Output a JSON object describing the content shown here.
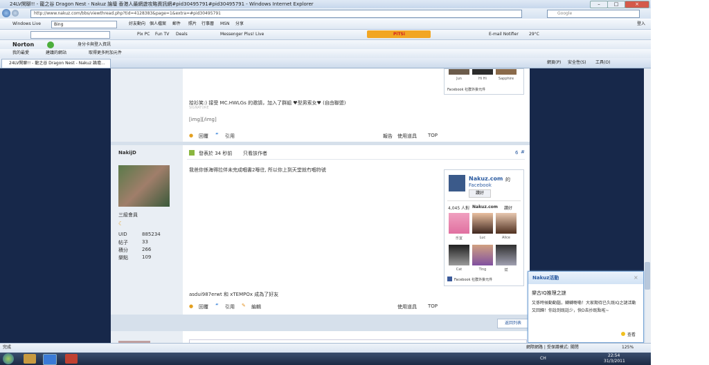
{
  "window": {
    "title": "24LV閑聊!! - 龍之谷 Dragon Nest - Nakuz 論壇 香港人最網遊攻略資訊網#pid30495791#pid30495791 - Windows Internet Explorer",
    "min": "–",
    "max": "□",
    "close": "×"
  },
  "address": {
    "url": "http://www.nakuz.com/bbs/viewthread.php?tid=4128383&page=1&extra=#pid30495791",
    "search_placeholder": "Google"
  },
  "toolbar_live": {
    "brand": "Windows Live",
    "search_value": "Bing",
    "items": [
      "好友動向",
      "個人檔案",
      "郵件",
      "照片",
      "行事曆",
      "MSN",
      "分享"
    ],
    "signin": "登入"
  },
  "toolbar_tools": {
    "items": [
      "Pix PC",
      "Fun TV",
      "Deals",
      "Messenger Plus! Live"
    ],
    "brand": "PiTSi",
    "email": "E-mail Notifier",
    "weather": "29°C"
  },
  "toolbar_norton": {
    "brand": "Norton",
    "identity": "身分卡與登入資訊"
  },
  "favorites": {
    "label": "我的最愛",
    "items": [
      "建議的網站",
      "取得更多附加元件"
    ]
  },
  "tab": {
    "label": "24LV閑聊!! - 龍之谷 Dragon Nest - Nakuz 論壇..."
  },
  "commandbar": {
    "page": "網頁(P)",
    "safety": "安全性(S)",
    "tools": "工具(O)"
  },
  "post1": {
    "fb_names": [
      "Jun",
      "Hi Hi",
      "Sapphire"
    ],
    "fb_plugin": "Facebook 社群外掛元件",
    "gift_text": "拾衫笑:) 接受 MC.HWLGs 的邀請，加入了群組 ♥型男索女♥ (自由聯盟)",
    "signature": "SIGNATURE",
    "img_text": "[img][/img]",
    "reply": "回覆",
    "quote": "引用",
    "report": "報告",
    "use_item": "使用道具",
    "top": "TOP"
  },
  "post2": {
    "author": "NakijD",
    "rank": "三級會員",
    "stats": [
      {
        "label": "UID",
        "value": "885234"
      },
      {
        "label": "帖子",
        "value": "33"
      },
      {
        "label": "積分",
        "value": "266"
      },
      {
        "label": "樂點",
        "value": "109"
      }
    ],
    "time": "發表於 34 秒前",
    "only_author": "只看該作者",
    "floor": "6",
    "floor_suffix": "#",
    "message": "我爸你係海得拉伴未完成嗰書2喺往, 所以你上到天堂就冇嗰符號",
    "fb": {
      "title": "Nakuz.com",
      "title_suffix": "的",
      "sub": "Facebook",
      "like": "讚好",
      "count_text": "4,045 人對",
      "count_brand": "Nakuz.com",
      "count_suffix": "讚好",
      "friends": [
        "乐宜",
        "Luc",
        "Alice",
        "Cat",
        "Ting",
        "斌"
      ],
      "plugin": "Facebook 社群外掛元件"
    },
    "rate_text": "asdui987erwt 和 xTEMPOx 成為了好友",
    "reply": "回覆",
    "quote": "引用",
    "edit": "編輯",
    "use_item": "使用道具",
    "top": "TOP",
    "back": "返回列表"
  },
  "popup": {
    "title": "Nakuz活動",
    "close": "×",
    "heading": "樂古IQ推理之謎",
    "body": "又係時候動動腦，轉轉嘢嘞！大家期待已久既IQ之謎活動又回歸！你諗到既話少，快D去抄既點啦~",
    "action": "查看"
  },
  "status": {
    "left": "完成",
    "zone": "網際網路 | 受保護模式: 關閉",
    "zoom": "125%"
  },
  "taskbar": {
    "time": "22:54",
    "date": "31/3/2011",
    "lang": "CH"
  },
  "colors": {
    "page_bg": "#17284a",
    "sidebar": "#e9eef4",
    "link": "#2a5aa0"
  }
}
